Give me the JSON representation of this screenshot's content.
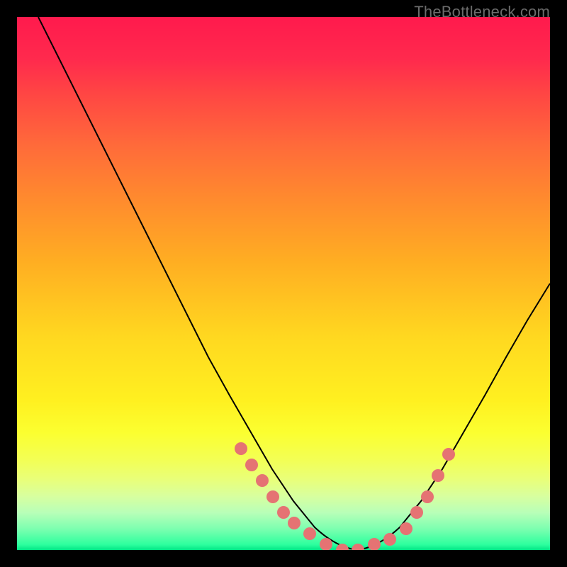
{
  "watermark": "TheBottleneck.com",
  "chart_data": {
    "type": "line",
    "title": "",
    "xlabel": "",
    "ylabel": "",
    "xlim": [
      0,
      100
    ],
    "ylim": [
      0,
      100
    ],
    "grid": false,
    "series": [
      {
        "name": "curve",
        "x": [
          4,
          8,
          12,
          16,
          20,
          24,
          28,
          32,
          36,
          40,
          44,
          48,
          52,
          56,
          60,
          64,
          68,
          72,
          76,
          80,
          84,
          88,
          92,
          96,
          100
        ],
        "y": [
          100,
          92,
          84,
          76,
          68,
          60,
          52,
          44,
          36,
          29,
          22,
          15,
          9,
          4,
          1,
          0,
          1,
          4,
          9,
          15,
          22,
          29,
          36,
          43,
          50
        ]
      }
    ],
    "markers": {
      "name": "highlighted-points",
      "x": [
        42,
        44,
        46,
        48,
        50,
        52,
        55,
        58,
        61,
        64,
        67,
        70,
        73,
        75,
        77,
        79,
        81
      ],
      "y": [
        19,
        16,
        13,
        10,
        7,
        5,
        3,
        1,
        0,
        0,
        1,
        2,
        4,
        7,
        10,
        14,
        18
      ]
    }
  }
}
